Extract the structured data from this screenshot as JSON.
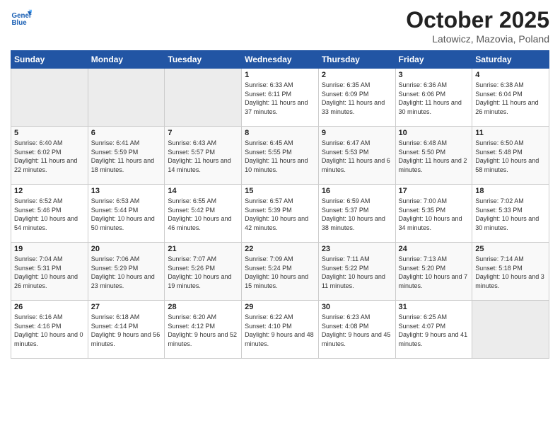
{
  "header": {
    "logo_line1": "General",
    "logo_line2": "Blue",
    "month": "October 2025",
    "location": "Latowicz, Mazovia, Poland"
  },
  "weekdays": [
    "Sunday",
    "Monday",
    "Tuesday",
    "Wednesday",
    "Thursday",
    "Friday",
    "Saturday"
  ],
  "weeks": [
    [
      {
        "day": "",
        "empty": true
      },
      {
        "day": "",
        "empty": true
      },
      {
        "day": "",
        "empty": true
      },
      {
        "day": "1",
        "rise": "6:33 AM",
        "set": "6:11 PM",
        "daylight": "11 hours and 37 minutes."
      },
      {
        "day": "2",
        "rise": "6:35 AM",
        "set": "6:09 PM",
        "daylight": "11 hours and 33 minutes."
      },
      {
        "day": "3",
        "rise": "6:36 AM",
        "set": "6:06 PM",
        "daylight": "11 hours and 30 minutes."
      },
      {
        "day": "4",
        "rise": "6:38 AM",
        "set": "6:04 PM",
        "daylight": "11 hours and 26 minutes."
      }
    ],
    [
      {
        "day": "5",
        "rise": "6:40 AM",
        "set": "6:02 PM",
        "daylight": "11 hours and 22 minutes."
      },
      {
        "day": "6",
        "rise": "6:41 AM",
        "set": "5:59 PM",
        "daylight": "11 hours and 18 minutes."
      },
      {
        "day": "7",
        "rise": "6:43 AM",
        "set": "5:57 PM",
        "daylight": "11 hours and 14 minutes."
      },
      {
        "day": "8",
        "rise": "6:45 AM",
        "set": "5:55 PM",
        "daylight": "11 hours and 10 minutes."
      },
      {
        "day": "9",
        "rise": "6:47 AM",
        "set": "5:53 PM",
        "daylight": "11 hours and 6 minutes."
      },
      {
        "day": "10",
        "rise": "6:48 AM",
        "set": "5:50 PM",
        "daylight": "11 hours and 2 minutes."
      },
      {
        "day": "11",
        "rise": "6:50 AM",
        "set": "5:48 PM",
        "daylight": "10 hours and 58 minutes."
      }
    ],
    [
      {
        "day": "12",
        "rise": "6:52 AM",
        "set": "5:46 PM",
        "daylight": "10 hours and 54 minutes."
      },
      {
        "day": "13",
        "rise": "6:53 AM",
        "set": "5:44 PM",
        "daylight": "10 hours and 50 minutes."
      },
      {
        "day": "14",
        "rise": "6:55 AM",
        "set": "5:42 PM",
        "daylight": "10 hours and 46 minutes."
      },
      {
        "day": "15",
        "rise": "6:57 AM",
        "set": "5:39 PM",
        "daylight": "10 hours and 42 minutes."
      },
      {
        "day": "16",
        "rise": "6:59 AM",
        "set": "5:37 PM",
        "daylight": "10 hours and 38 minutes."
      },
      {
        "day": "17",
        "rise": "7:00 AM",
        "set": "5:35 PM",
        "daylight": "10 hours and 34 minutes."
      },
      {
        "day": "18",
        "rise": "7:02 AM",
        "set": "5:33 PM",
        "daylight": "10 hours and 30 minutes."
      }
    ],
    [
      {
        "day": "19",
        "rise": "7:04 AM",
        "set": "5:31 PM",
        "daylight": "10 hours and 26 minutes."
      },
      {
        "day": "20",
        "rise": "7:06 AM",
        "set": "5:29 PM",
        "daylight": "10 hours and 23 minutes."
      },
      {
        "day": "21",
        "rise": "7:07 AM",
        "set": "5:26 PM",
        "daylight": "10 hours and 19 minutes."
      },
      {
        "day": "22",
        "rise": "7:09 AM",
        "set": "5:24 PM",
        "daylight": "10 hours and 15 minutes."
      },
      {
        "day": "23",
        "rise": "7:11 AM",
        "set": "5:22 PM",
        "daylight": "10 hours and 11 minutes."
      },
      {
        "day": "24",
        "rise": "7:13 AM",
        "set": "5:20 PM",
        "daylight": "10 hours and 7 minutes."
      },
      {
        "day": "25",
        "rise": "7:14 AM",
        "set": "5:18 PM",
        "daylight": "10 hours and 3 minutes."
      }
    ],
    [
      {
        "day": "26",
        "rise": "6:16 AM",
        "set": "4:16 PM",
        "daylight": "10 hours and 0 minutes."
      },
      {
        "day": "27",
        "rise": "6:18 AM",
        "set": "4:14 PM",
        "daylight": "9 hours and 56 minutes."
      },
      {
        "day": "28",
        "rise": "6:20 AM",
        "set": "4:12 PM",
        "daylight": "9 hours and 52 minutes."
      },
      {
        "day": "29",
        "rise": "6:22 AM",
        "set": "4:10 PM",
        "daylight": "9 hours and 48 minutes."
      },
      {
        "day": "30",
        "rise": "6:23 AM",
        "set": "4:08 PM",
        "daylight": "9 hours and 45 minutes."
      },
      {
        "day": "31",
        "rise": "6:25 AM",
        "set": "4:07 PM",
        "daylight": "9 hours and 41 minutes."
      },
      {
        "day": "",
        "empty": true
      }
    ]
  ]
}
